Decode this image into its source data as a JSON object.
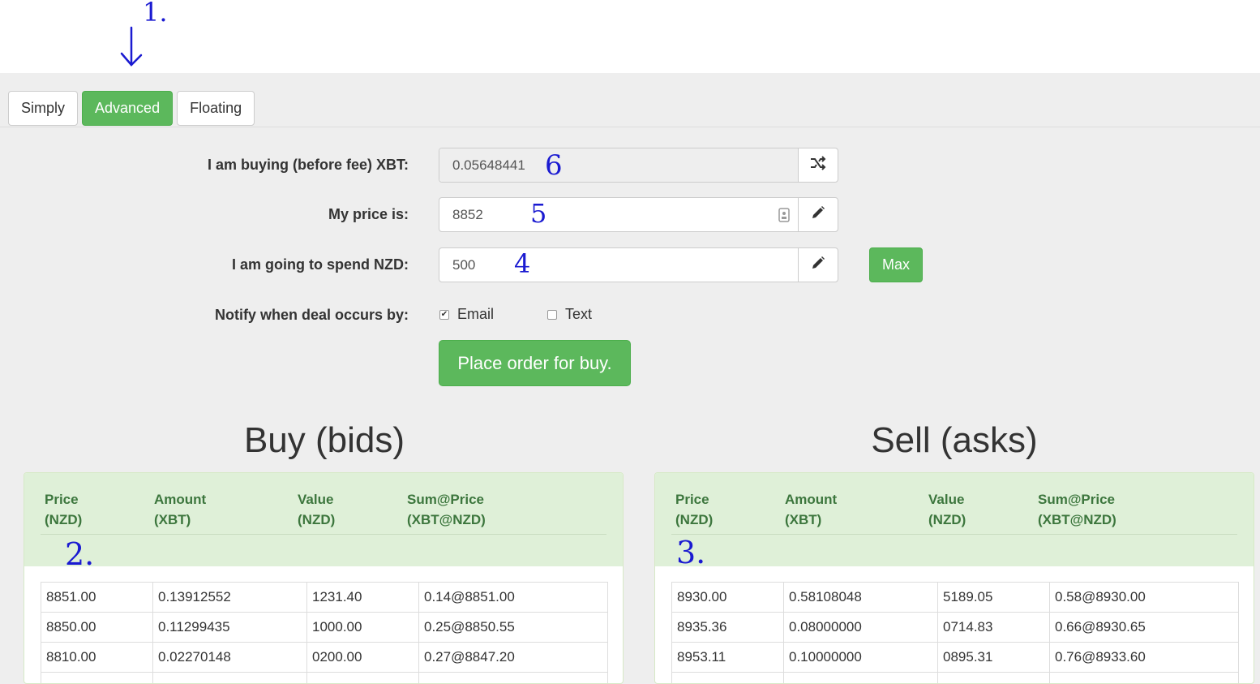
{
  "annotations": {
    "n1": "1.",
    "n2": "2.",
    "n3": "3.",
    "n4": "4",
    "n5": "5",
    "n6": "6"
  },
  "tabs": [
    {
      "label": "Simply",
      "active": false
    },
    {
      "label": "Advanced",
      "active": true
    },
    {
      "label": "Floating",
      "active": false
    }
  ],
  "form": {
    "buying_label": "I am buying (before fee) XBT:",
    "buying_value": "0.05648441",
    "price_label": "My price is:",
    "price_value": "8852",
    "spend_label": "I am going to spend NZD:",
    "spend_value": "500",
    "max_label": "Max",
    "notify_label": "Notify when deal occurs by:",
    "notify_email_label": "Email",
    "notify_email_checked": true,
    "notify_text_label": "Text",
    "notify_text_checked": false,
    "place_order_label": "Place order for buy."
  },
  "icons": {
    "swap": "shuffle-icon",
    "edit": "pencil-icon",
    "contact": "contact-card-icon"
  },
  "colors": {
    "accent": "#5cb85c",
    "panel_header": "#dff0d8",
    "header_text": "#3c763d"
  },
  "bids": {
    "title": "Buy (bids)",
    "headers": [
      {
        "l1": "Price",
        "l2": "(NZD)"
      },
      {
        "l1": "Amount",
        "l2": "(XBT)"
      },
      {
        "l1": "Value",
        "l2": "(NZD)"
      },
      {
        "l1": "Sum@Price",
        "l2": "(XBT@NZD)"
      }
    ],
    "rows": [
      [
        "8851.00",
        "0.13912552",
        "1231.40",
        "0.14@8851.00"
      ],
      [
        "8850.00",
        "0.11299435",
        "1000.00",
        "0.25@8850.55"
      ],
      [
        "8810.00",
        "0.02270148",
        "0200.00",
        "0.27@8847.20"
      ]
    ]
  },
  "asks": {
    "title": "Sell (asks)",
    "headers": [
      {
        "l1": "Price",
        "l2": "(NZD)"
      },
      {
        "l1": "Amount",
        "l2": "(XBT)"
      },
      {
        "l1": "Value",
        "l2": "(NZD)"
      },
      {
        "l1": "Sum@Price",
        "l2": "(XBT@NZD)"
      }
    ],
    "rows": [
      [
        "8930.00",
        "0.58108048",
        "5189.05",
        "0.58@8930.00"
      ],
      [
        "8935.36",
        "0.08000000",
        "0714.83",
        "0.66@8930.65"
      ],
      [
        "8953.11",
        "0.10000000",
        "0895.31",
        "0.76@8933.60"
      ]
    ]
  }
}
